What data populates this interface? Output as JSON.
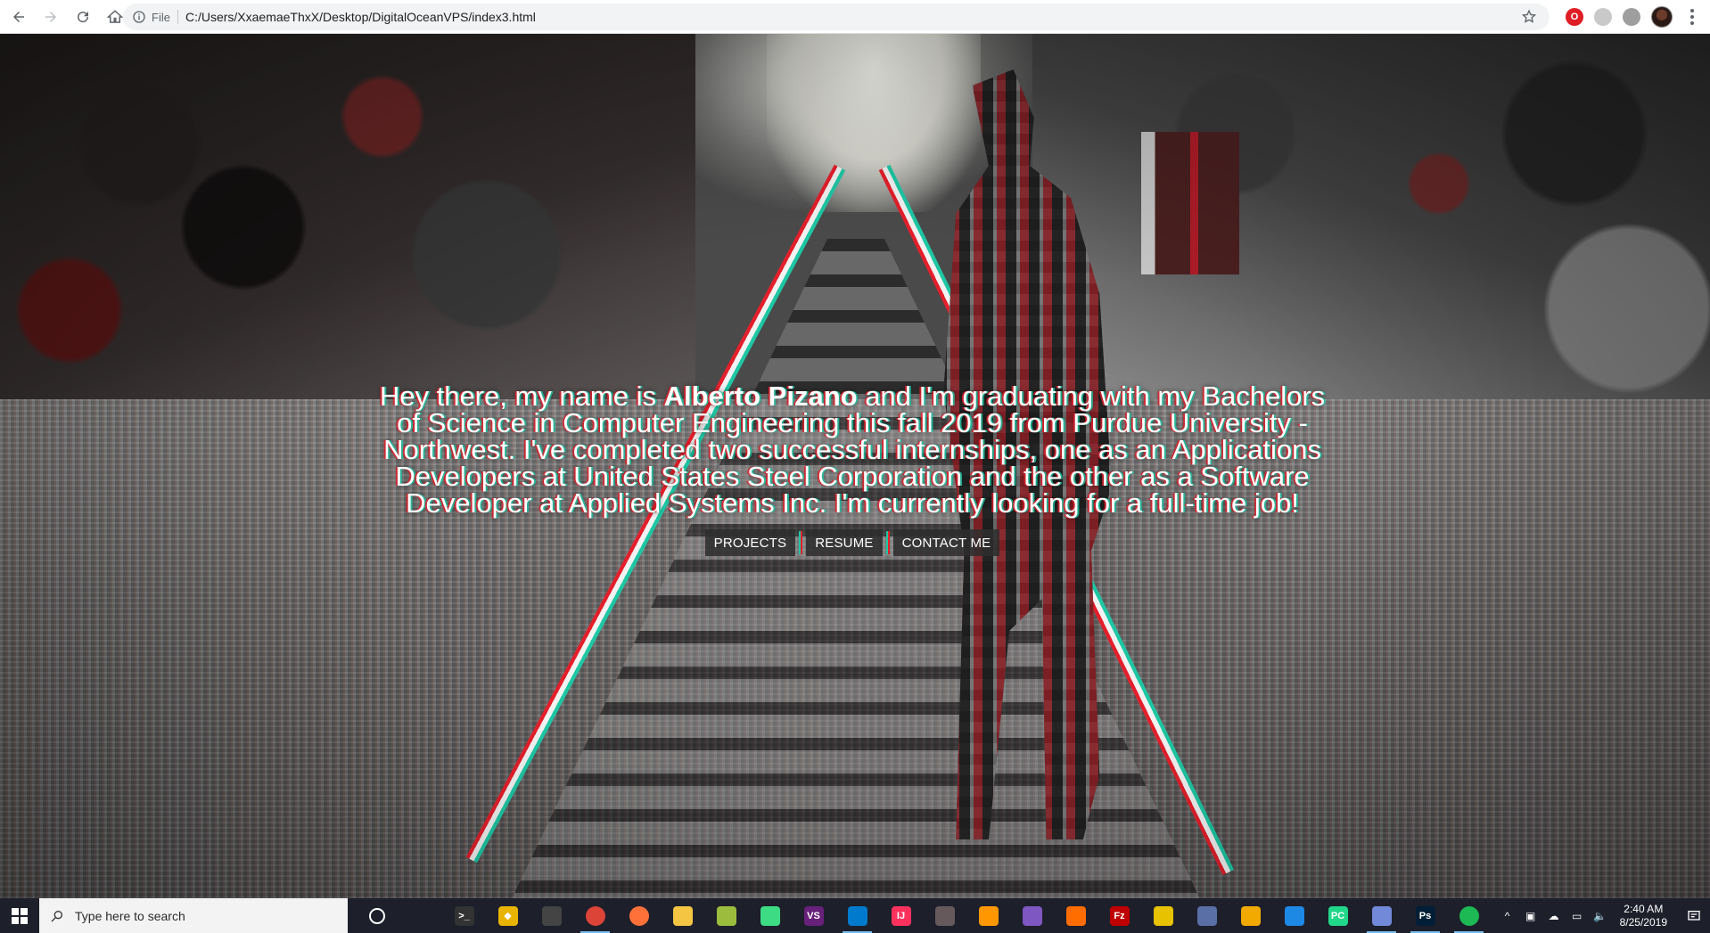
{
  "browser": {
    "url_scheme": "File",
    "url": "C:/Users/XxaemaeThxX/Desktop/DigitalOceanVPS/index3.html"
  },
  "hero": {
    "intro_before": "Hey there, my name is ",
    "intro_name": "Alberto Pizano",
    "intro_after": " and I'm graduating with my Bachelors of Science in Computer Engineering this fall 2019 from Purdue University - Northwest. I've completed two successful internships, one as an Applications Developers at United States Steel Corporation and the other as a Software Developer at Applied Systems Inc. I'm currently looking for a full-time job!",
    "buttons": [
      "PROJECTS",
      "RESUME",
      "CONTACT ME"
    ]
  },
  "taskbar": {
    "search_placeholder": "Type here to search",
    "time": "2:40 AM",
    "date": "8/25/2019",
    "apps": [
      {
        "name": "cortana-icon",
        "label": "",
        "color": "#1d1f2b"
      },
      {
        "name": "task-view-icon",
        "label": "",
        "color": "#1d1f2b"
      },
      {
        "name": "terminal-icon",
        "label": ">_",
        "color": "#333333"
      },
      {
        "name": "diamond-app-icon",
        "label": "◆",
        "color": "#e8b400"
      },
      {
        "name": "window-app-icon",
        "label": "",
        "color": "#444444"
      },
      {
        "name": "chrome-icon",
        "label": "",
        "color": "#db4437"
      },
      {
        "name": "firefox-icon",
        "label": "",
        "color": "#ff7139"
      },
      {
        "name": "file-explorer-icon",
        "label": "",
        "color": "#f4c542"
      },
      {
        "name": "paint-icon",
        "label": "",
        "color": "#9cbc3e"
      },
      {
        "name": "android-studio-icon",
        "label": "",
        "color": "#3ddc84"
      },
      {
        "name": "visual-studio-icon",
        "label": "VS",
        "color": "#68217a"
      },
      {
        "name": "vscode-icon",
        "label": "",
        "color": "#007acc"
      },
      {
        "name": "intellij-icon",
        "label": "IJ",
        "color": "#fe315d"
      },
      {
        "name": "atom-icon",
        "label": "",
        "color": "#66595c"
      },
      {
        "name": "sublime-icon",
        "label": "",
        "color": "#ff9800"
      },
      {
        "name": "purple-app-icon",
        "label": "",
        "color": "#7e57c2"
      },
      {
        "name": "orange-app-icon",
        "label": "",
        "color": "#ff6d00"
      },
      {
        "name": "filezilla-icon",
        "label": "Fz",
        "color": "#bf0000"
      },
      {
        "name": "yellow-app-icon",
        "label": "",
        "color": "#e6c200"
      },
      {
        "name": "bar-app-icon",
        "label": "",
        "color": "#5a6fa6"
      },
      {
        "name": "sql-app-icon",
        "label": "",
        "color": "#f2a900"
      },
      {
        "name": "cube-app-icon",
        "label": "",
        "color": "#1e88e5"
      },
      {
        "name": "pycharm-icon",
        "label": "PC",
        "color": "#21d789"
      },
      {
        "name": "discord-icon",
        "label": "",
        "color": "#7289da"
      },
      {
        "name": "photoshop-icon",
        "label": "Ps",
        "color": "#001e36"
      },
      {
        "name": "spotify-icon",
        "label": "",
        "color": "#1db954"
      }
    ]
  }
}
